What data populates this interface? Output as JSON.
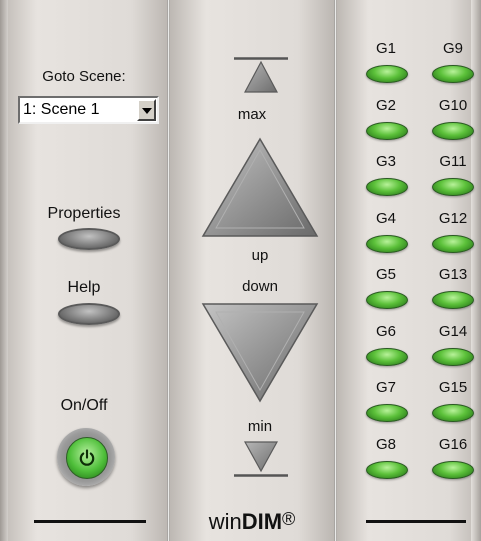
{
  "left_panel": {
    "goto_scene_label": "Goto Scene:",
    "scene_select_value": "1: Scene 1",
    "properties_label": "Properties",
    "help_label": "Help",
    "onoff_label": "On/Off"
  },
  "center_panel": {
    "max_label": "max",
    "up_label": "up",
    "down_label": "down",
    "min_label": "min",
    "brand_win": "win",
    "brand_dim": "DIM",
    "brand_reg": "®"
  },
  "groups": {
    "left_column": [
      "G1",
      "G2",
      "G3",
      "G4",
      "G5",
      "G6",
      "G7",
      "G8"
    ],
    "right_column": [
      "G9",
      "G10",
      "G11",
      "G12",
      "G13",
      "G14",
      "G15",
      "G16"
    ],
    "led_color": "#5cc13a"
  },
  "icons": {
    "power": "power-icon",
    "dropdown": "chevron-down-icon"
  }
}
